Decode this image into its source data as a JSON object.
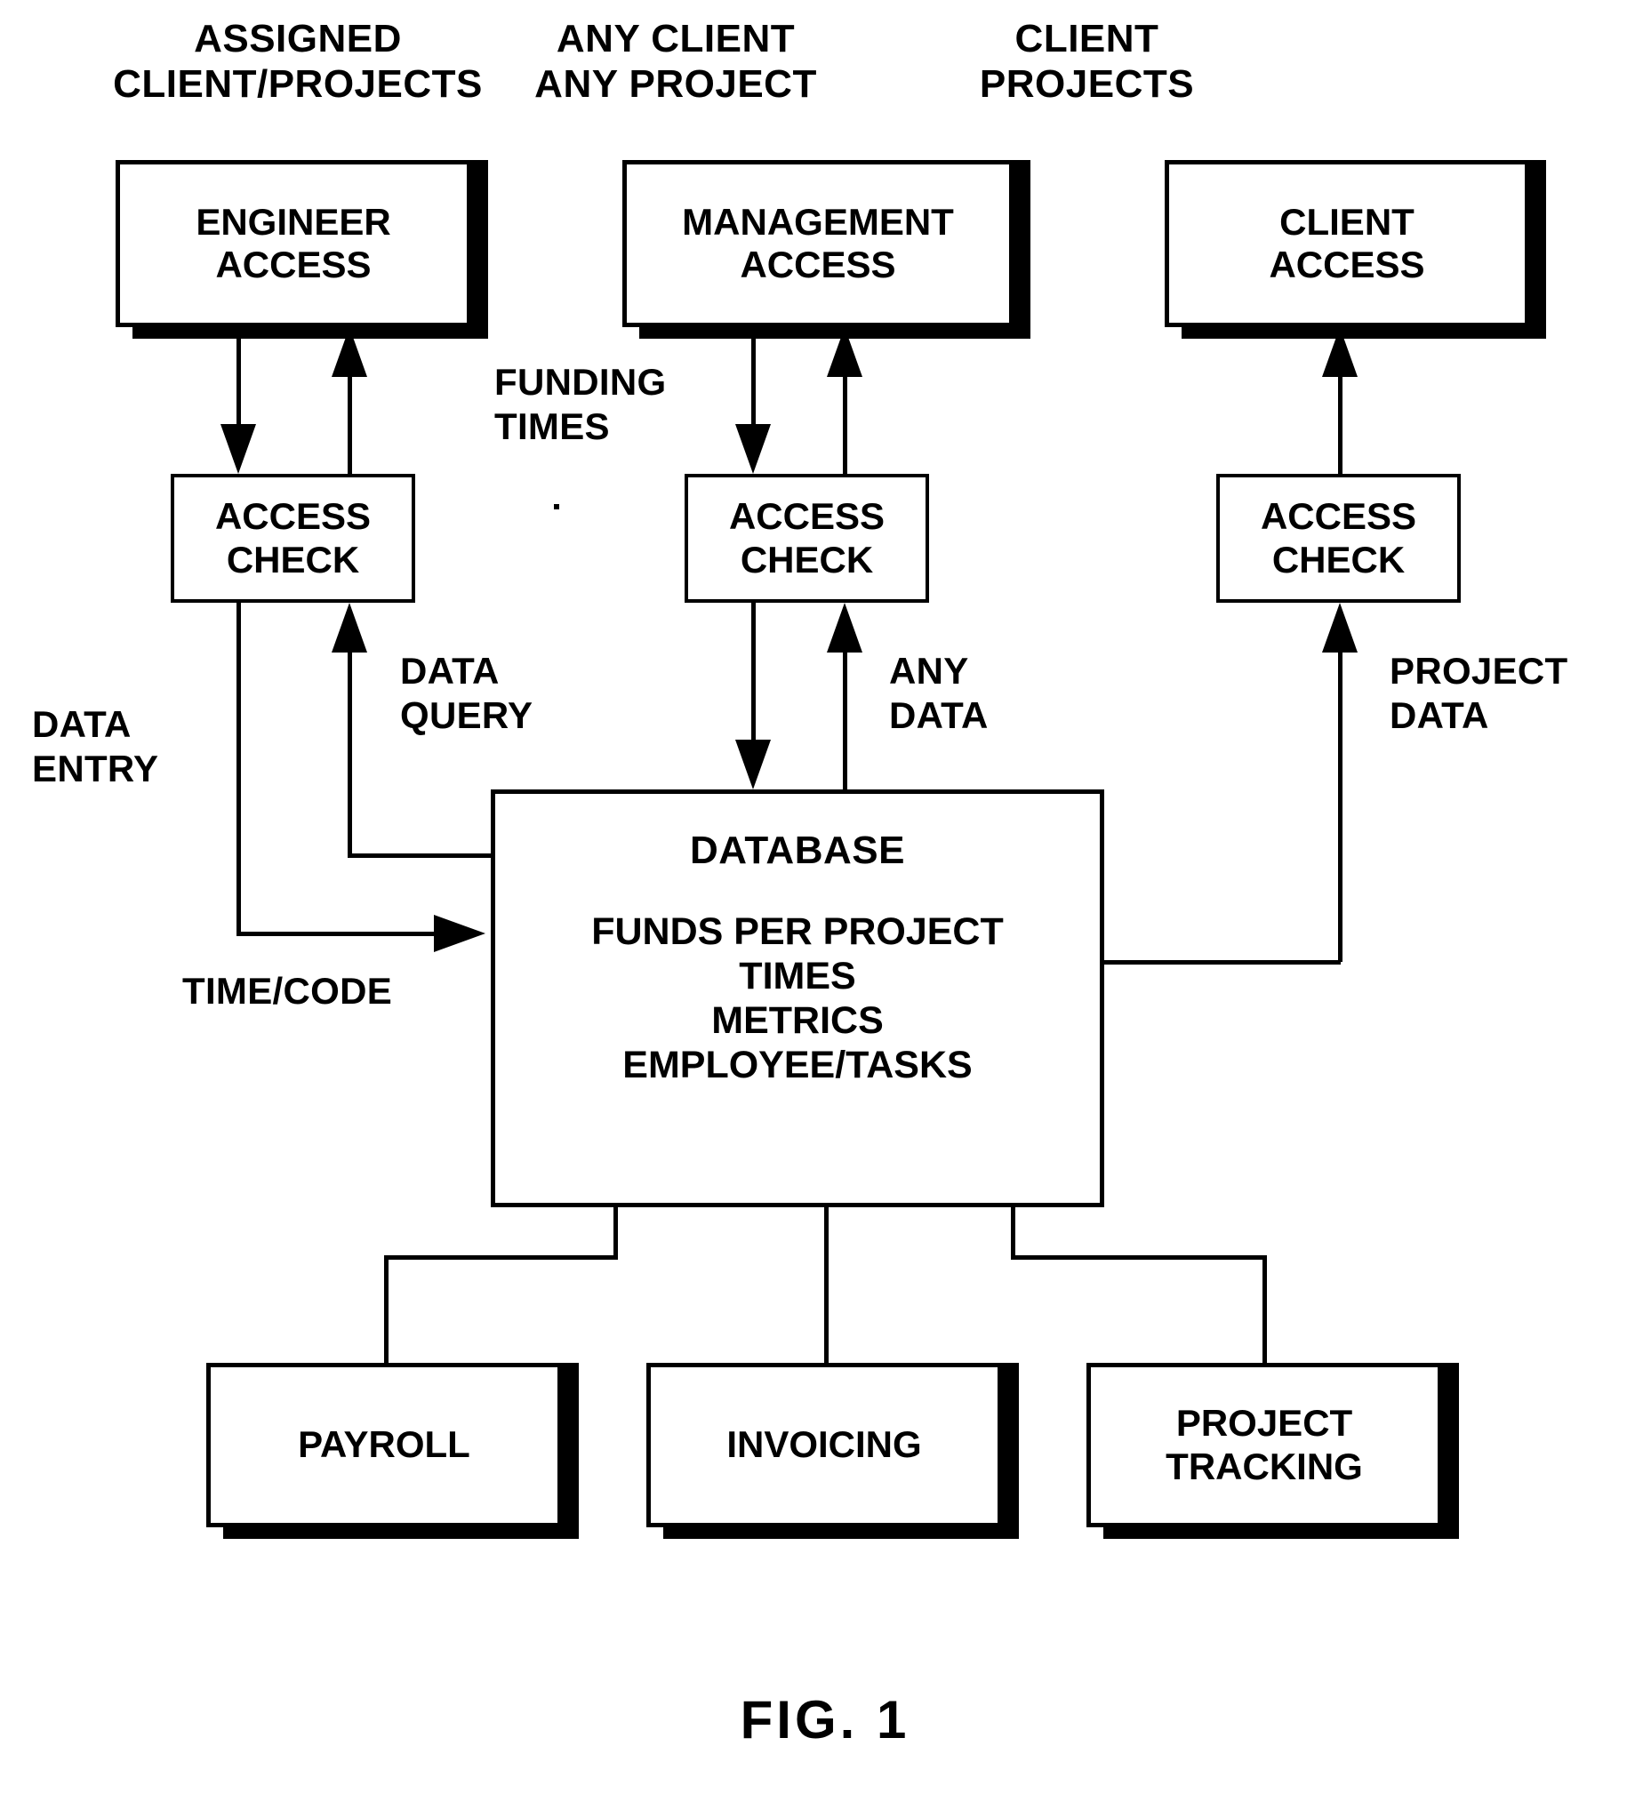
{
  "figure": {
    "caption": "FIG. 1"
  },
  "columns": [
    {
      "header": "ASSIGNED\nCLIENT/PROJECTS"
    },
    {
      "header": "ANY CLIENT\nANY PROJECT"
    },
    {
      "header": "CLIENT\nPROJECTS"
    }
  ],
  "access_nodes": [
    {
      "label": "ENGINEER\nACCESS"
    },
    {
      "label": "MANAGEMENT\nACCESS"
    },
    {
      "label": "CLIENT\nACCESS"
    }
  ],
  "check_nodes": [
    {
      "label": "ACCESS\nCHECK"
    },
    {
      "label": "ACCESS\nCHECK"
    },
    {
      "label": "ACCESS\nCHECK"
    }
  ],
  "flow_labels": {
    "funding_times": "FUNDING\nTIMES",
    "data_entry": "DATA\nENTRY",
    "data_query": "DATA\nQUERY",
    "time_code": "TIME/CODE",
    "any_data": "ANY\nDATA",
    "project_data": "PROJECT\nDATA"
  },
  "database": {
    "title": "DATABASE",
    "lines": [
      "FUNDS PER PROJECT",
      "TIMES",
      "METRICS",
      "EMPLOYEE/TASKS"
    ]
  },
  "output_nodes": [
    {
      "label": "PAYROLL"
    },
    {
      "label": "INVOICING"
    },
    {
      "label": "PROJECT\nTRACKING"
    }
  ],
  "colors": {
    "ink": "#000000",
    "paper": "#ffffff"
  }
}
